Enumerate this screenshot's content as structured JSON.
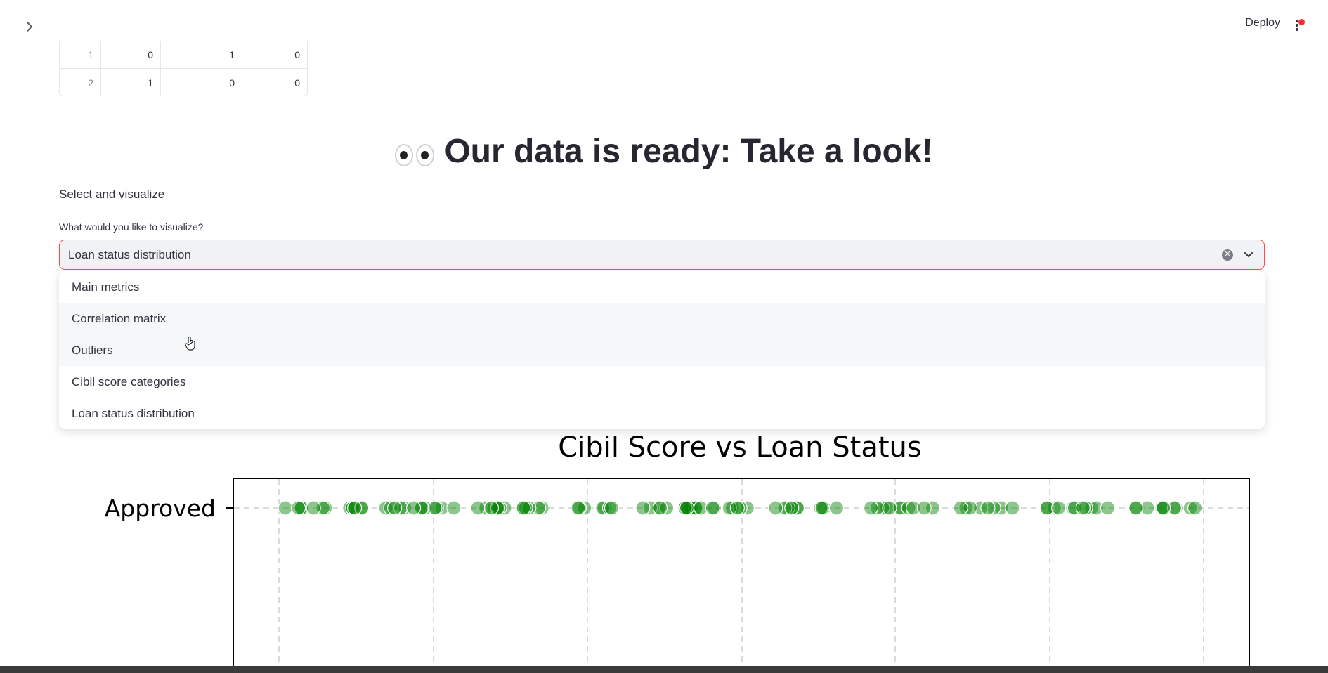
{
  "header": {
    "deploy_label": "Deploy"
  },
  "table": {
    "rows": [
      {
        "index": "1",
        "c1": "0",
        "c2": "1",
        "c3": "0"
      },
      {
        "index": "2",
        "c1": "1",
        "c2": "0",
        "c3": "0"
      }
    ]
  },
  "title": "Our data is ready: Take a look!",
  "section_label": "Select and visualize",
  "select": {
    "label": "What would you like to visualize?",
    "value": "Loan status distribution",
    "options": [
      "Main metrics",
      "Correlation matrix",
      "Outliers",
      "Cibil score categories",
      "Loan status distribution"
    ],
    "hovered_option": "Outliers"
  },
  "chart_data": {
    "type": "scatter",
    "title": "Cibil Score vs Loan Status",
    "y_categories": [
      "Approved"
    ],
    "series": [
      {
        "category": "Approved",
        "x_range": [
          300,
          900
        ],
        "color": "#008000"
      }
    ],
    "grid": true
  }
}
